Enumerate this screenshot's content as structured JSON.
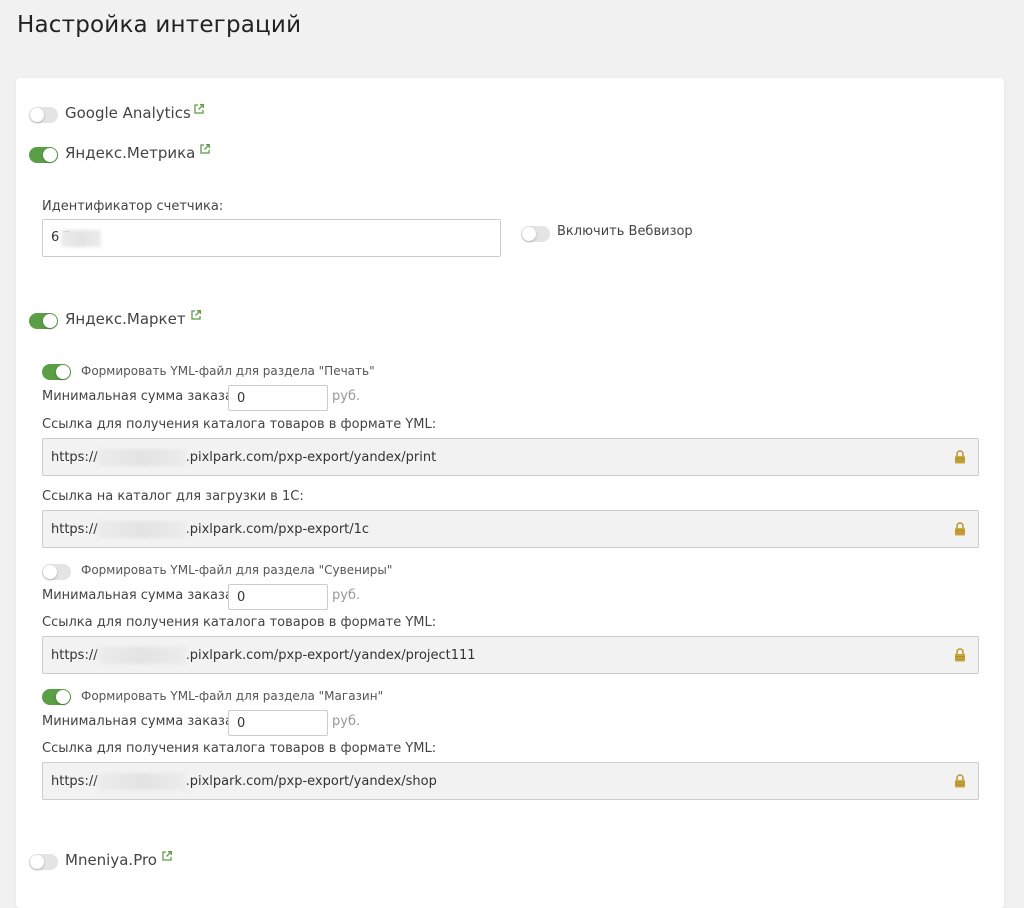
{
  "page": {
    "title": "Настройка интеграций"
  },
  "integrations": {
    "google": {
      "label": "Google Analytics",
      "enabled": false
    },
    "metrika": {
      "label": "Яндекс.Метрика",
      "enabled": true,
      "counter_label": "Идентификатор счетчика:",
      "counter_value": "6          2",
      "webvisor_label": "Включить Вебвизор",
      "webvisor_enabled": false
    },
    "market": {
      "label": "Яндекс.Маркет",
      "enabled": true,
      "sections": [
        {
          "toggle_label": "Формировать YML-файл для раздела \"Печать\"",
          "enabled": true,
          "min_label": "Минимальная сумма заказа:",
          "min_value": "0",
          "currency": "руб.",
          "link_label": "Ссылка для получения каталога товаров в формате YML:",
          "url_prefix": "https://",
          "url_suffix": ".pixlpark.com/pxp-export/yandex/print",
          "onec_label": "Ссылка на каталог для загрузки в 1С:",
          "onec_url_suffix": ".pixlpark.com/pxp-export/1c"
        },
        {
          "toggle_label": "Формировать YML-файл для раздела \"Сувениры\"",
          "enabled": false,
          "min_label": "Минимальная сумма заказа:",
          "min_value": "0",
          "currency": "руб.",
          "link_label": "Ссылка для получения каталога товаров в формате YML:",
          "url_prefix": "https://",
          "url_suffix": ".pixlpark.com/pxp-export/yandex/project111"
        },
        {
          "toggle_label": "Формировать YML-файл для раздела \"Магазин\"",
          "enabled": true,
          "min_label": "Минимальная сумма заказа:",
          "min_value": "0",
          "currency": "руб.",
          "link_label": "Ссылка для получения каталога товаров в формате YML:",
          "url_prefix": "https://",
          "url_suffix": ".pixlpark.com/pxp-export/yandex/shop"
        }
      ]
    },
    "mneniya": {
      "label": "Mneniya.Pro",
      "enabled": false
    }
  },
  "icons": {
    "external": "external-link-icon",
    "lock": "lock-icon"
  },
  "colors": {
    "toggle_on": "#5a9e45",
    "toggle_off": "#e4e4e4",
    "link_icon": "#5a9e45",
    "lock": "#b8962a"
  }
}
